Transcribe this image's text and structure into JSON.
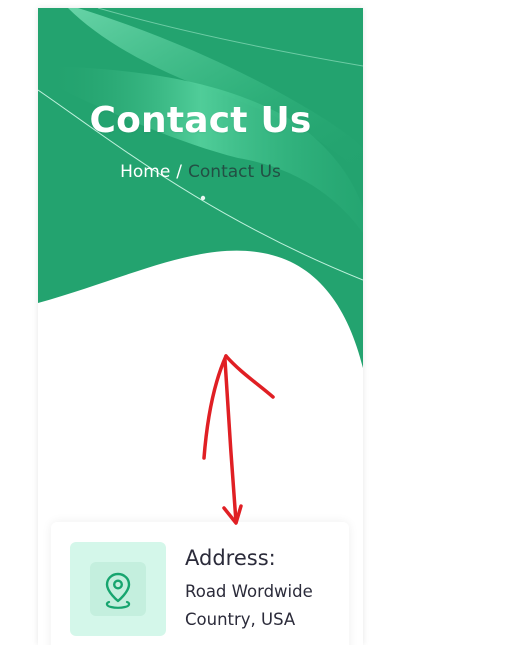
{
  "hero": {
    "title": "Contact Us",
    "breadcrumb": {
      "home": "Home",
      "separator": "/",
      "current": "Contact Us"
    },
    "colors": {
      "primary": "#23a36f",
      "light": "#6ee3b2",
      "current_crumb": "#234f44"
    }
  },
  "address_card": {
    "icon": "location-pin-icon",
    "title": "Address:",
    "lines": [
      "Road Wordwide",
      "Country, USA"
    ],
    "icon_bg": "#d4f7ea",
    "icon_color": "#17a56f"
  },
  "annotation": {
    "type": "red-double-arrow",
    "color": "#e01f24"
  }
}
